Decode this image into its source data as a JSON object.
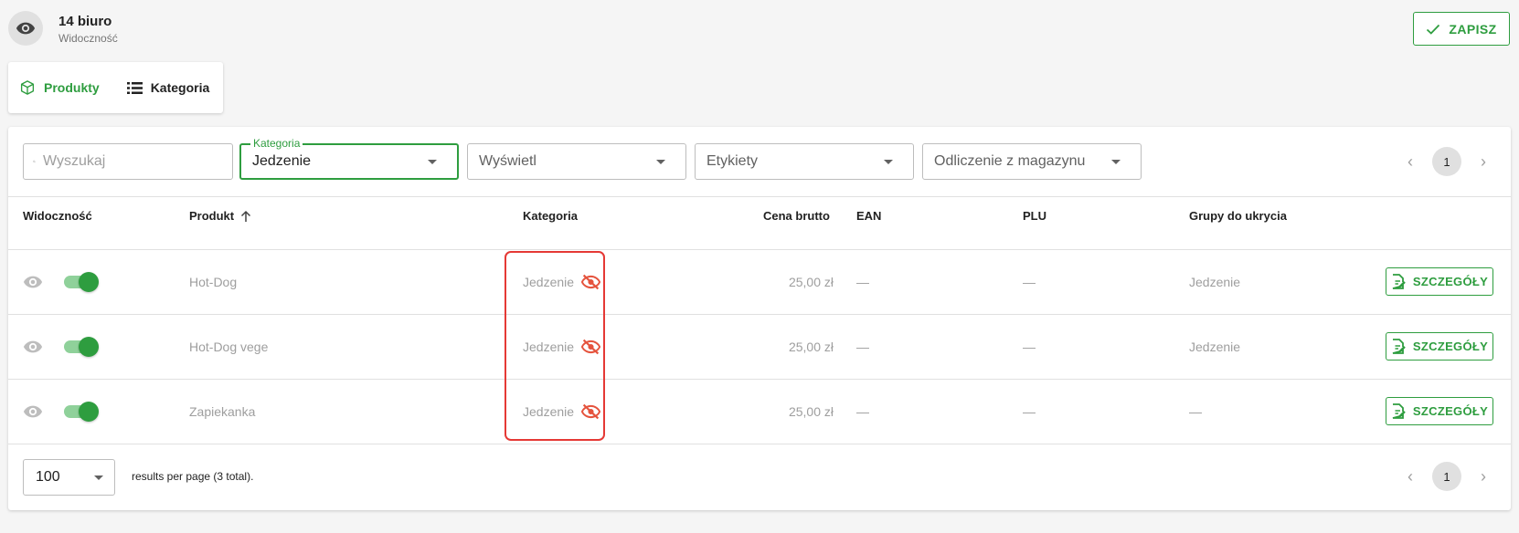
{
  "header": {
    "title": "14 biuro",
    "subtitle": "Widoczność",
    "save_label": "ZAPISZ"
  },
  "tabs": [
    {
      "label": "Produkty",
      "icon": "cube-icon",
      "active": true
    },
    {
      "label": "Kategoria",
      "icon": "list-icon",
      "active": false
    }
  ],
  "filters": {
    "search_placeholder": "Wyszukaj",
    "category_label": "Kategoria",
    "category_value": "Jedzenie",
    "show_value": "Wyświetl",
    "labels_value": "Etykiety",
    "stock_value": "Odliczenie z magazynu"
  },
  "pagination": {
    "current_page": "1",
    "prev": "‹",
    "next": "›"
  },
  "table": {
    "headers": {
      "visibility": "Widoczność",
      "product": "Produkt",
      "category": "Kategoria",
      "price": "Cena brutto",
      "ean": "EAN",
      "plu": "PLU",
      "groups": "Grupy do ukrycia"
    },
    "rows": [
      {
        "product": "Hot-Dog",
        "category": "Jedzenie",
        "price": "25,00 zł",
        "ean": "—",
        "plu": "—",
        "groups": "Jedzenie",
        "action": "SZCZEGÓŁY",
        "enabled": true
      },
      {
        "product": "Hot-Dog vege",
        "category": "Jedzenie",
        "price": "25,00 zł",
        "ean": "—",
        "plu": "—",
        "groups": "Jedzenie",
        "action": "SZCZEGÓŁY",
        "enabled": true
      },
      {
        "product": "Zapiekanka",
        "category": "Jedzenie",
        "price": "25,00 zł",
        "ean": "—",
        "plu": "—",
        "groups": "—",
        "action": "SZCZEGÓŁY",
        "enabled": true
      }
    ]
  },
  "footer": {
    "per_page": "100",
    "results_text": "results per page (3 total)."
  },
  "colors": {
    "accent": "#2e9d3f",
    "hidden_icon": "#e5533d",
    "highlight": "#e53935"
  }
}
